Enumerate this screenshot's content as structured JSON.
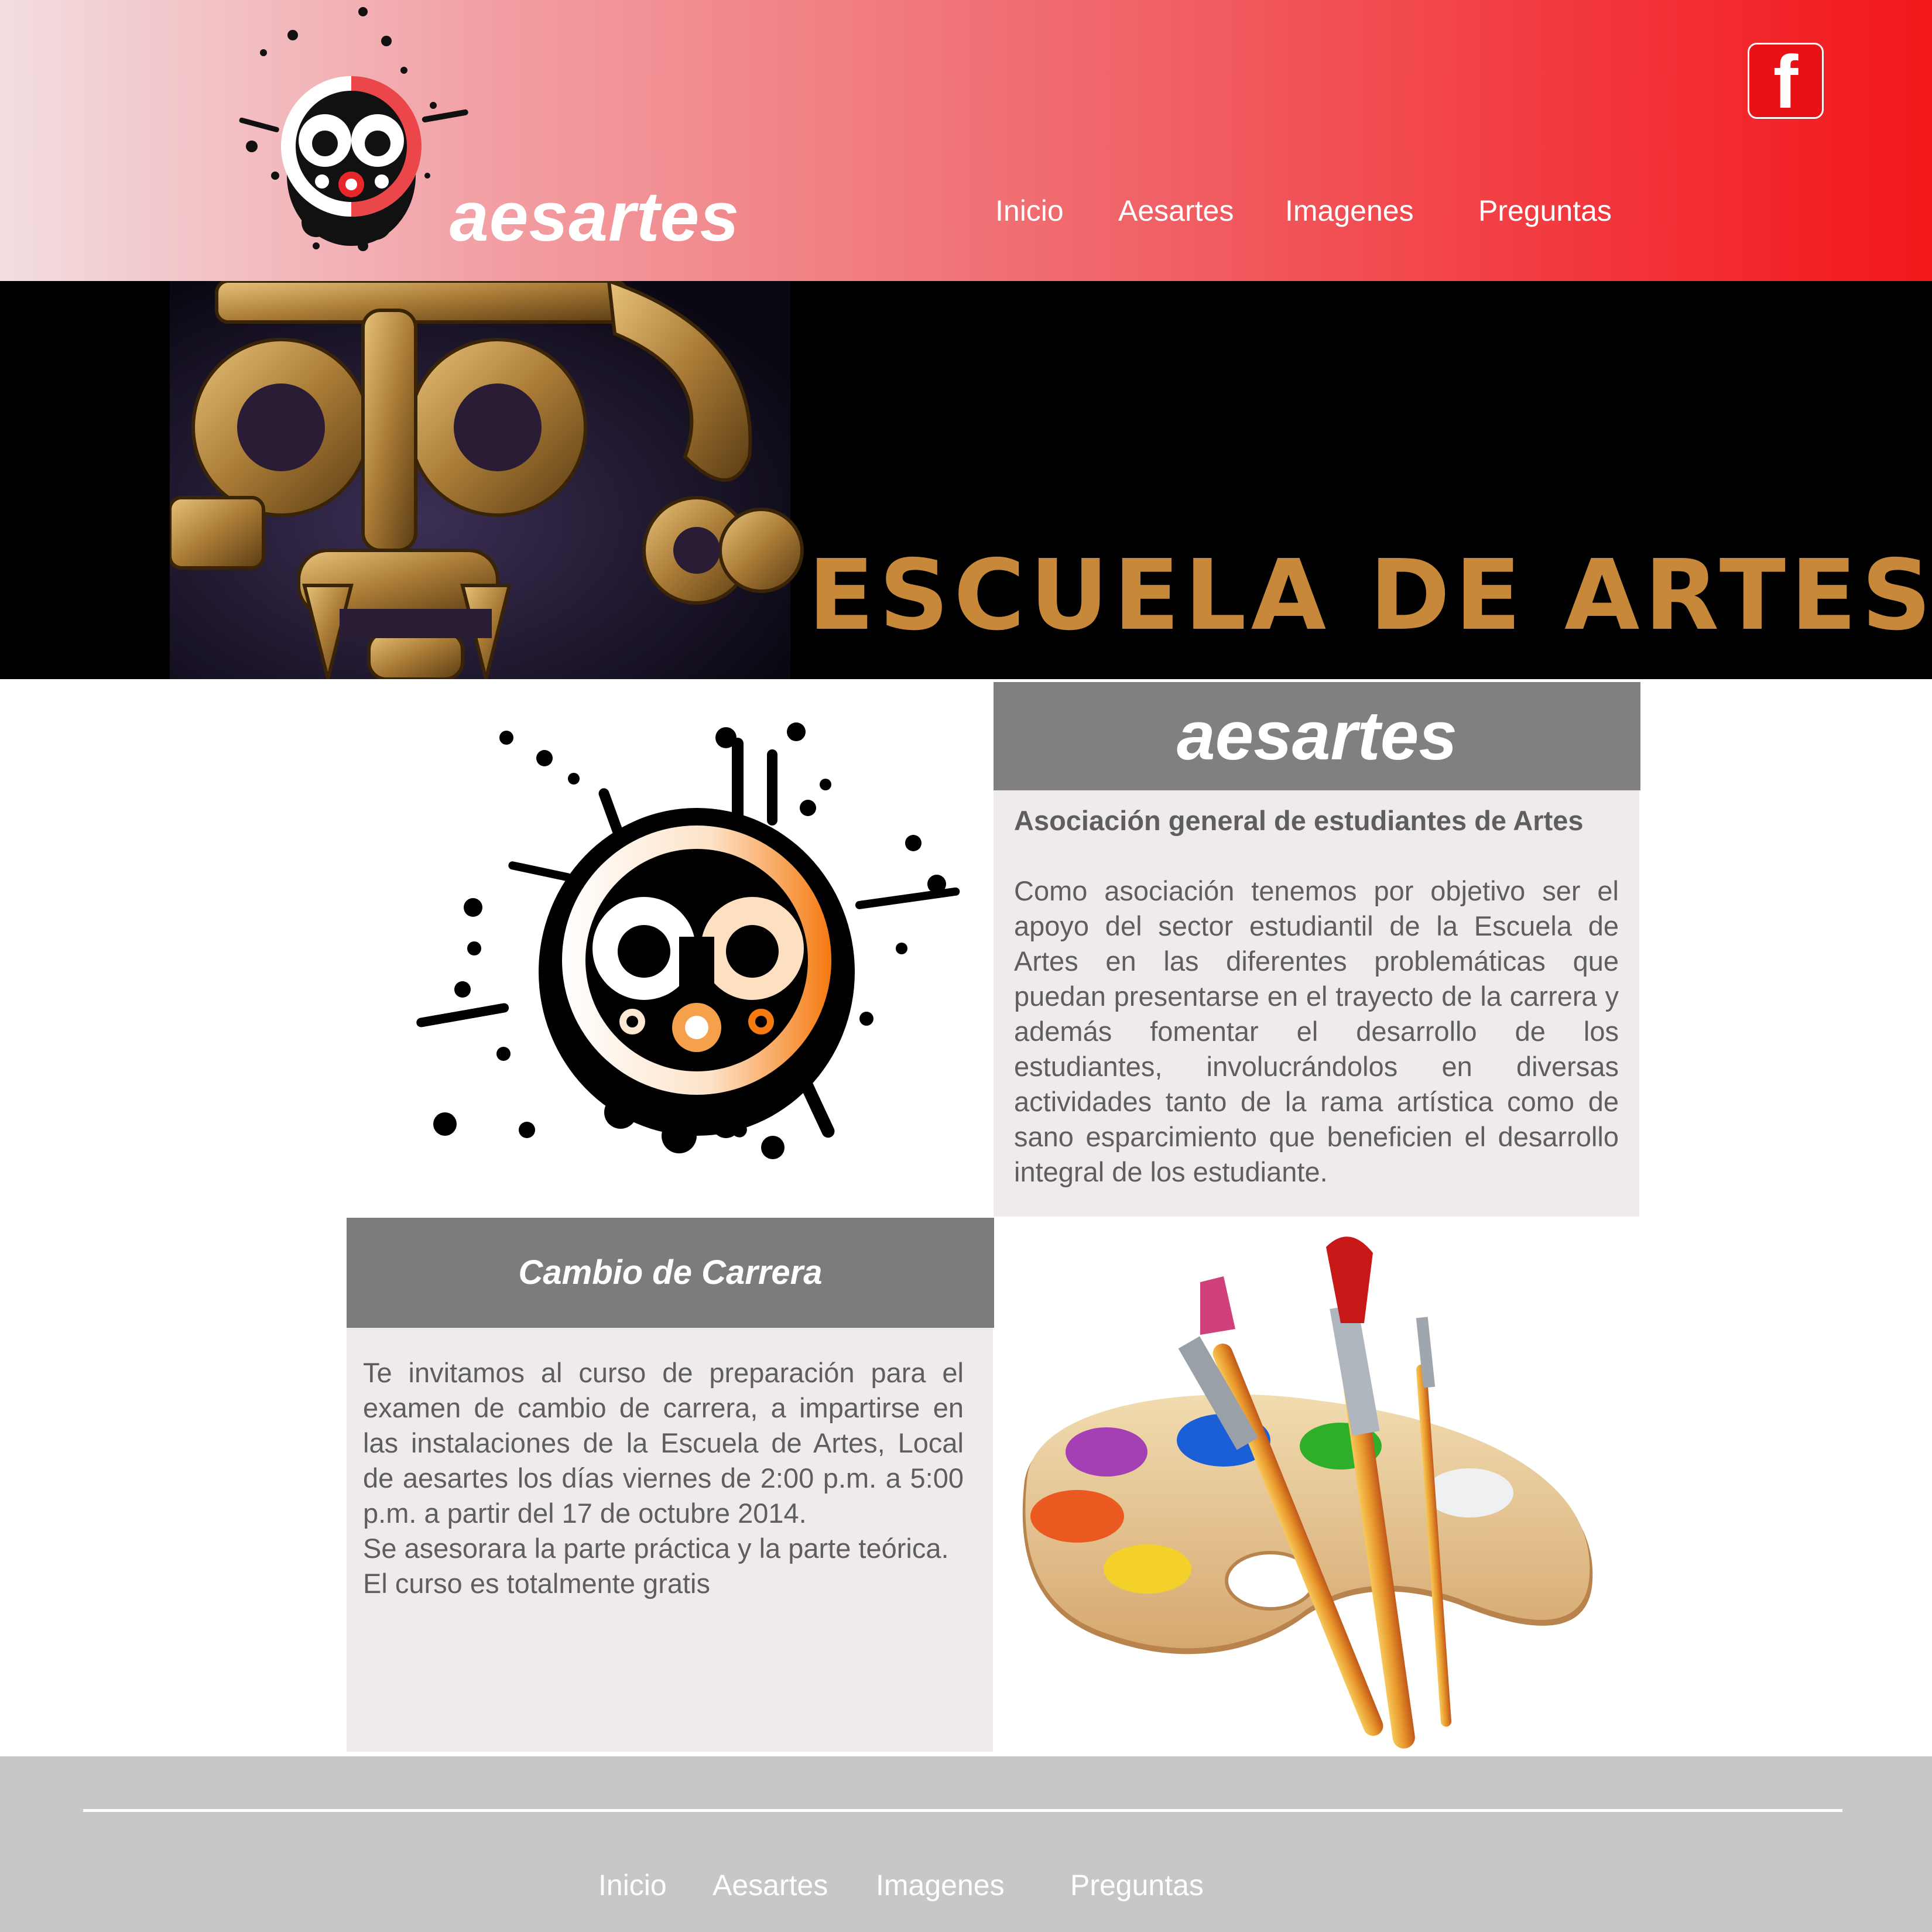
{
  "header": {
    "brand": "aesartes",
    "nav": [
      "Inicio",
      "Aesartes",
      "Imagenes",
      "Preguntas"
    ],
    "social_icon": "facebook-icon",
    "social_glyph": "f"
  },
  "banner": {
    "title": "ESCUELA DE ARTES"
  },
  "about": {
    "heading": "aesartes",
    "subtitle": "Asociación general de estudiantes de Artes",
    "paragraph": "Como asociación tenemos por objetivo ser el apoyo del sector estudiantil de la Escuela de Artes en las diferentes problemáticas que puedan presentarse en el trayecto de la carrera y además fomentar el desarrollo de los estudiantes, involucrándolos en diversas actividades tanto de la rama artística como de sano esparcimiento que beneficien el desarrollo integral de los estudiante."
  },
  "course": {
    "heading": "Cambio de Carrera",
    "paragraph1": "Te invitamos al curso de preparación para el examen de cambio de carrera, a impartirse en las instalaciones de la Escuela de Artes, Local de aesartes los días viernes de 2:00 p.m. a 5:00 p.m. a partir del 17 de octubre 2014.",
    "paragraph2": "Se asesorara la parte práctica  y la parte teórica.",
    "paragraph3": "El curso es totalmente gratis"
  },
  "footer": {
    "nav": [
      "Inicio",
      "Aesartes",
      "Imagenes",
      "Preguntas"
    ]
  },
  "colors": {
    "header_end": "#f2171b",
    "header_start": "#f2dde0",
    "banner_text": "#c8883a",
    "panel_head": "#808080",
    "panel_body": "#efebea",
    "footer": "#c8c7c8",
    "accent_orange": "#f57a10"
  }
}
